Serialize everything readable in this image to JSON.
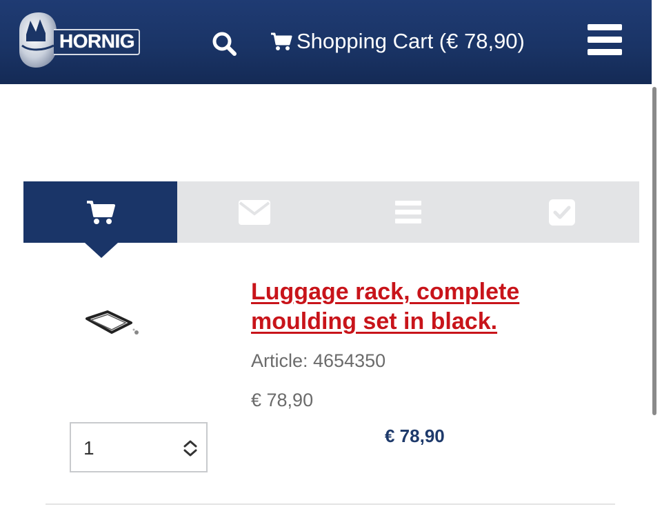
{
  "header": {
    "logo_text": "HORNIG",
    "cart_label": "Shopping Cart (€ 78,90)",
    "icons": {
      "search": "search-icon",
      "cart": "shopping-cart-icon",
      "menu": "hamburger-menu-icon"
    }
  },
  "steps": [
    {
      "icon": "shopping-cart-icon",
      "active": true
    },
    {
      "icon": "envelope-icon",
      "active": false
    },
    {
      "icon": "list-icon",
      "active": false
    },
    {
      "icon": "check-square-icon",
      "active": false
    }
  ],
  "product": {
    "title": "Luggage rack, complete moulding set in black.",
    "article": "Article: 4654350",
    "price": "€ 78,90",
    "quantity": "1",
    "total": "€ 78,90"
  },
  "colors": {
    "header_bg": "#1a3466",
    "active_step": "#1a3568",
    "title_red": "#c8141a",
    "total_blue": "#1e3a6b"
  }
}
